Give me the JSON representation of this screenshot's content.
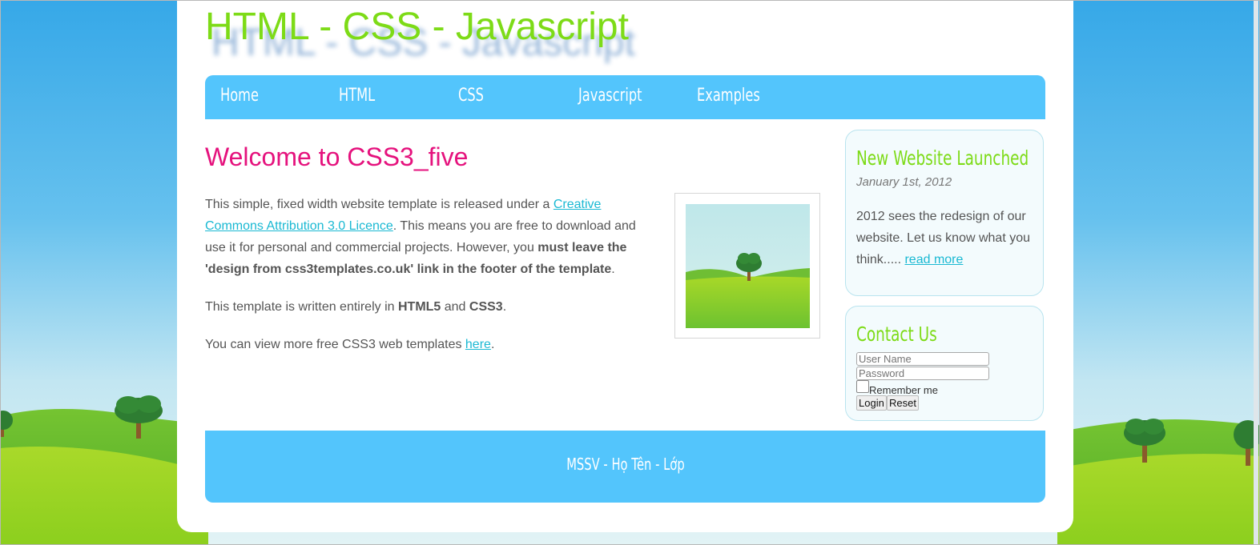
{
  "site": {
    "title": "HTML - CSS - Javascript"
  },
  "nav": {
    "items": [
      {
        "label": "Home"
      },
      {
        "label": "HTML"
      },
      {
        "label": "CSS"
      },
      {
        "label": "Javascript"
      },
      {
        "label": "Examples"
      }
    ]
  },
  "main": {
    "title": "Welcome to CSS3_five",
    "p1_before": "This simple, fixed width website template is released under a ",
    "p1_link": "Creative Commons Attribution 3.0 Licence",
    "p1_middle": ". This means you are free to download and use it for personal and commercial projects. However, you ",
    "p1_bold": "must leave the 'design from css3templates.co.uk' link in the footer of the template",
    "p1_end": ".",
    "p2_before": "This template is written entirely in ",
    "p2_bold1": "HTML5",
    "p2_and": " and ",
    "p2_bold2": "CSS3",
    "p2_end": ".",
    "p3_before": "You can view more free CSS3 web templates ",
    "p3_link": "here",
    "p3_end": "."
  },
  "sidebar": {
    "news": {
      "title": "New Website Launched",
      "date": "January 1st, 2012",
      "text": "2012 sees the redesign of our website. Let us know what you think..... ",
      "link": "read more"
    },
    "contact": {
      "title": "Contact Us",
      "username_placeholder": "User Name",
      "password_placeholder": "Password",
      "remember_label": "Remember me",
      "login_label": "Login",
      "reset_label": "Reset"
    }
  },
  "footer": {
    "text": "MSSV - Họ Tên - Lớp"
  },
  "colors": {
    "accent_blue": "#53c5fc",
    "title_green": "#7ddb17",
    "heading_pink": "#e5127d",
    "link_teal": "#1ab9d3"
  },
  "icons": [
    "tree-landscape-image",
    "tree-icon"
  ]
}
